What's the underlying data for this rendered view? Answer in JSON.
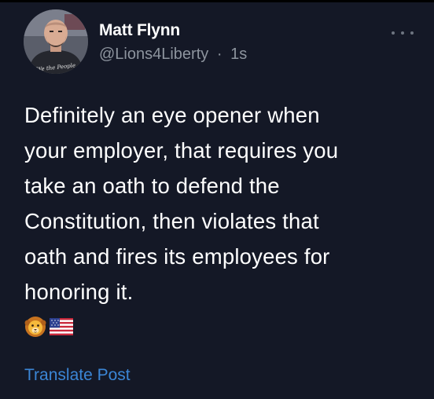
{
  "post": {
    "display_name": "Matt Flynn",
    "handle": "@Lions4Liberty",
    "separator": "·",
    "timestamp": "1s",
    "more_icon": "more-horizontal-icon",
    "body_lines": [
      "Definitely an eye opener when",
      "your employer, that requires you",
      "take an oath to defend the",
      "Constitution, then violates that",
      "oath and fires its employees for",
      "honoring it."
    ],
    "emojis": [
      "lion-face-icon",
      "us-flag-icon"
    ],
    "translate_label": "Translate Post",
    "avatar_shirt_text": "We the People"
  },
  "colors": {
    "background": "#141826",
    "text_primary": "#ffffff",
    "text_secondary": "#8d949e",
    "link": "#3b86d6"
  }
}
